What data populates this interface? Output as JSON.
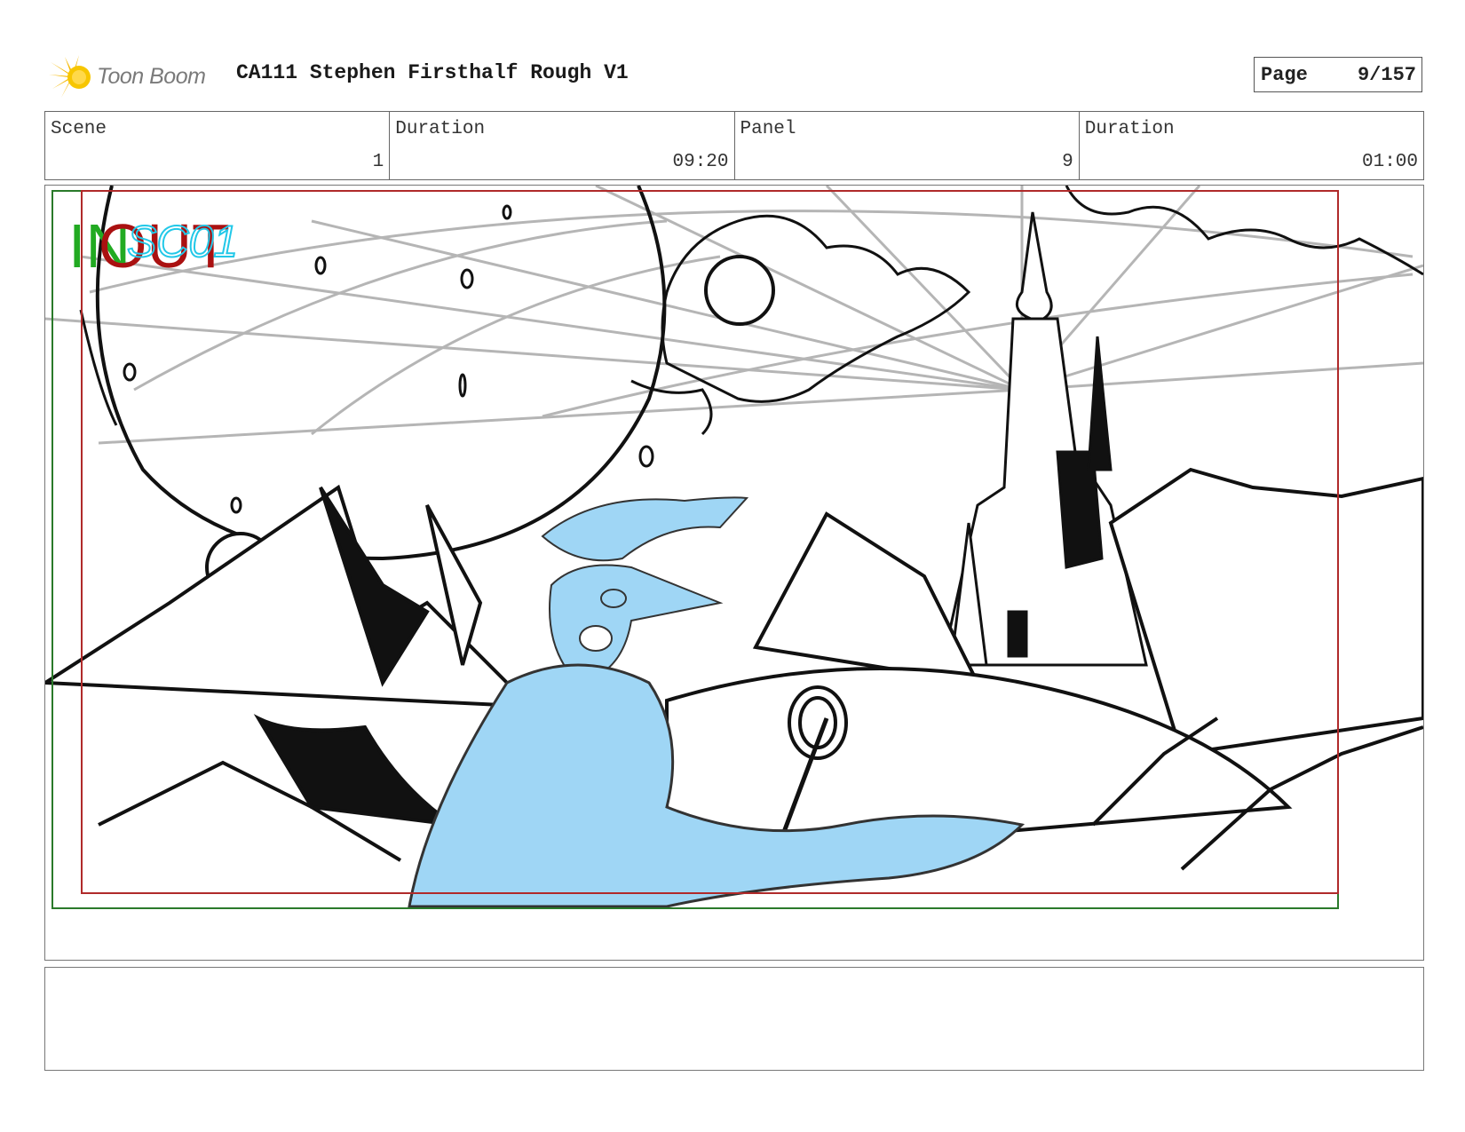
{
  "header": {
    "logo_text": "Toon Boom",
    "title": "CA111 Stephen Firsthalf Rough V1",
    "page_label": "Page",
    "page_value": "9/157"
  },
  "info": {
    "scene_label": "Scene",
    "scene_value": "1",
    "scene_duration_label": "Duration",
    "scene_duration_value": "09:20",
    "panel_label": "Panel",
    "panel_value": "9",
    "panel_duration_label": "Duration",
    "panel_duration_value": "01:00"
  },
  "panel": {
    "in_marker": "IN",
    "out_marker": "OUT",
    "sketch_note": "SC01"
  },
  "colors": {
    "in_marker": "#22aa22",
    "out_marker": "#aa1111",
    "sketch_note": "#22c8e8",
    "character_fill": "#9fd6f5",
    "frame_red": "#b02a2a",
    "frame_green": "#2a7a2a"
  },
  "notes": {
    "text": ""
  }
}
